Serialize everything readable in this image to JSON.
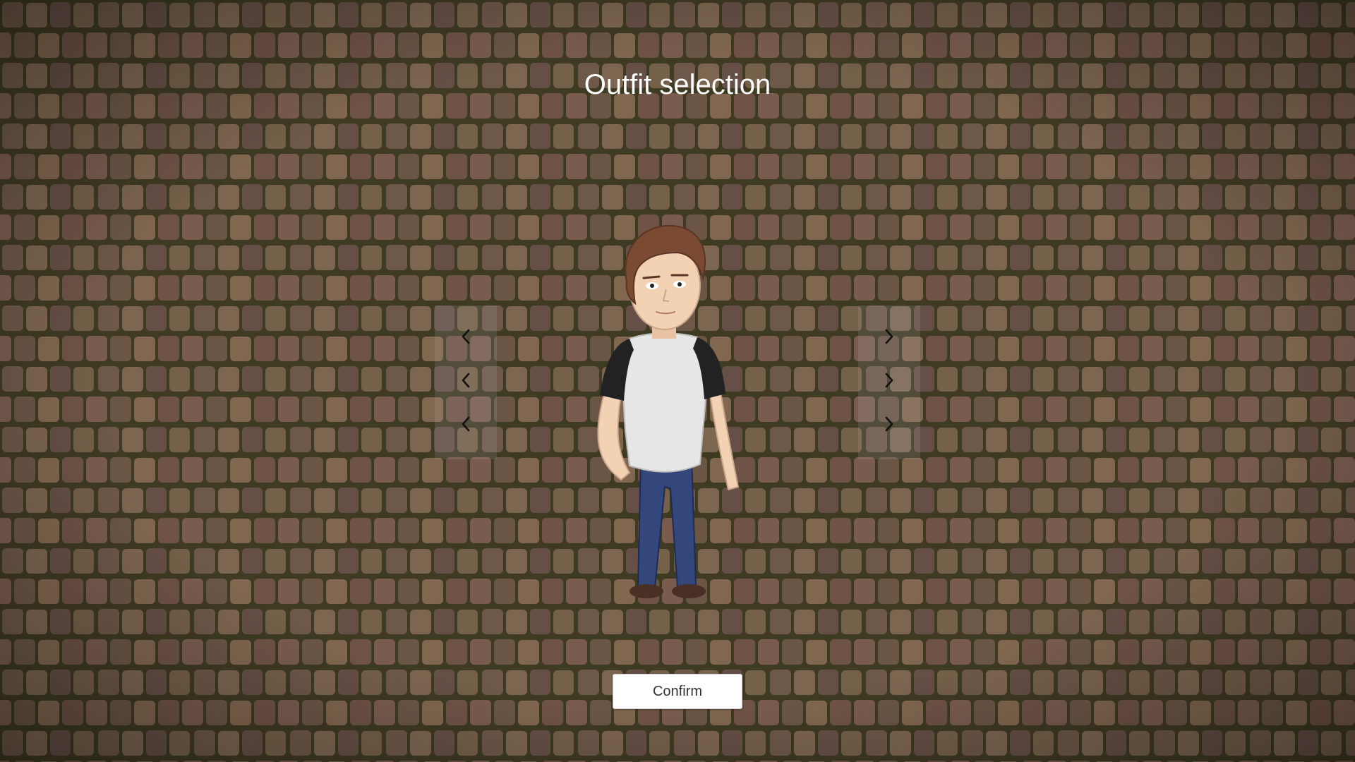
{
  "screen": {
    "title": "Outfit selection"
  },
  "outfit_selector": {
    "rows": [
      {
        "previous_icon": "chevron-left-icon",
        "next_icon": "chevron-right-icon"
      },
      {
        "previous_icon": "chevron-left-icon",
        "next_icon": "chevron-right-icon"
      },
      {
        "previous_icon": "chevron-left-icon",
        "next_icon": "chevron-right-icon"
      }
    ]
  },
  "character": {
    "hair_color": "#7a4a33",
    "skin_color": "#f3d2b4",
    "shirt_color": "#e6e6e6",
    "sleeve_color": "#222222",
    "pants_color": "#34477c",
    "shoe_color": "#4a2f24"
  },
  "actions": {
    "confirm_label": "Confirm"
  },
  "colors": {
    "title_text": "#ffffff",
    "button_background": "#ffffff",
    "button_text": "#333333"
  }
}
